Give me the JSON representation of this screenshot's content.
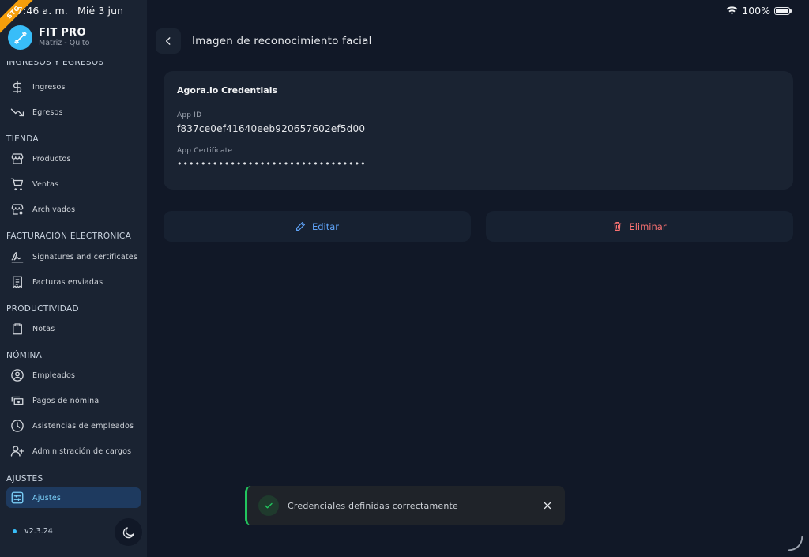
{
  "status_bar": {
    "time": "7:46 a. m.",
    "date": "Mié 3 jun",
    "battery": "100%"
  },
  "brand": {
    "ribbon": "STG",
    "name": "FIT PRO",
    "subtitle": "Matriz - Quito"
  },
  "sidebar": {
    "sections": {
      "finance": "INGRESOS Y EGRESOS",
      "store": "TIENDA",
      "billing": "FACTURACIÓN ELECTRÓNICA",
      "productivity": "PRODUCTIVIDAD",
      "payroll": "NÓMINA",
      "settings": "AJUSTES"
    },
    "items": {
      "income": "Ingresos",
      "expenses": "Egresos",
      "products": "Productos",
      "sales": "Ventas",
      "archived": "Archivados",
      "signatures": "Signatures and certificates",
      "invoices": "Facturas enviadas",
      "notes": "Notas",
      "employees": "Empleados",
      "payroll_payments": "Pagos de nómina",
      "attendance": "Asistencias de empleados",
      "roles": "Administración de cargos",
      "settings": "Ajustes"
    },
    "version": "v2.3.24"
  },
  "header": {
    "title": "Imagen de reconocimiento facial"
  },
  "card": {
    "title": "Agora.io Credentials",
    "app_id_label": "App ID",
    "app_id": "f837ce0ef41640eeb920657602ef5d00",
    "certificate_label": "App Certificate",
    "certificate": "••••••••••••••••••••••••••••••••"
  },
  "actions": {
    "edit": "Editar",
    "delete": "Eliminar"
  },
  "toast": {
    "message": "Credenciales definidas correctamente"
  },
  "colors": {
    "accent": "#38bdf8",
    "edit": "#60a5fa",
    "delete": "#f87171",
    "success": "#22c55e"
  }
}
